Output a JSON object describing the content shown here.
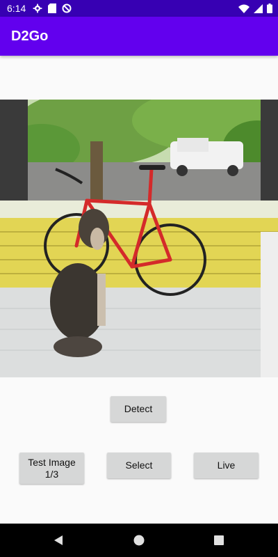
{
  "status_bar": {
    "time": "6:14",
    "icons_left": [
      "settings-icon",
      "sd-card-icon",
      "data-saver-icon"
    ],
    "icons_right": [
      "wifi-icon",
      "cellular-signal-icon",
      "battery-icon"
    ]
  },
  "app_bar": {
    "title": "D2Go"
  },
  "image": {
    "description_icon": "photo-image"
  },
  "buttons": {
    "detect": "Detect",
    "test_image": "Test Image\n1/3",
    "select": "Select",
    "live": "Live"
  },
  "nav_bar": {
    "icons": [
      "back-icon",
      "home-icon",
      "recents-icon"
    ]
  },
  "colors": {
    "status_bar": "#3700b3",
    "app_bar": "#6200ee",
    "button": "#d6d7d7",
    "background": "#fafafa"
  }
}
